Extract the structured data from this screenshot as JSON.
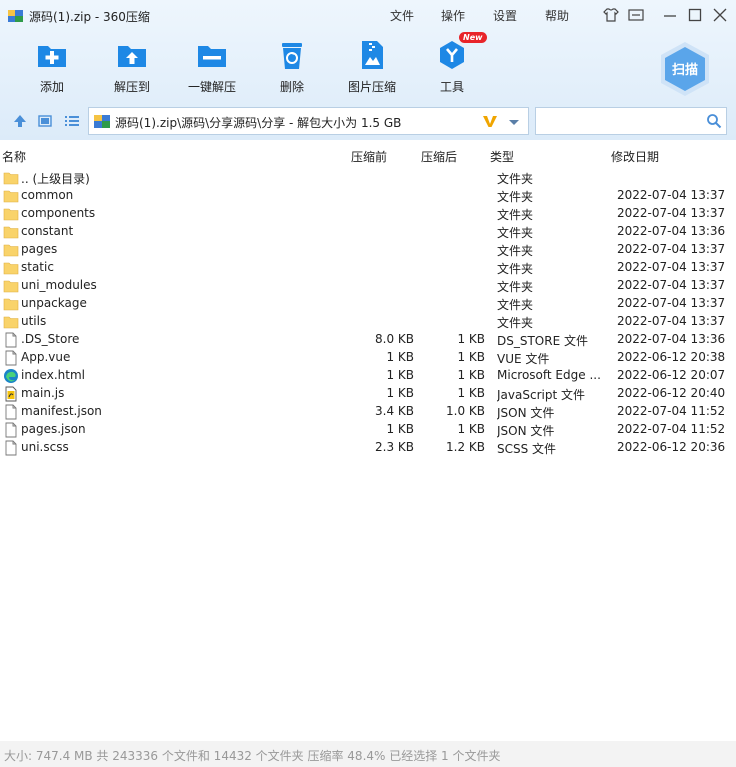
{
  "window": {
    "title": "源码(1).zip - 360压缩"
  },
  "menu": [
    "文件",
    "操作",
    "设置",
    "帮助"
  ],
  "toolbar": {
    "add": "添加",
    "extract_to": "解压到",
    "one_click": "一键解压",
    "delete": "删除",
    "image_compress": "图片压缩",
    "tools": "工具",
    "new_badge": "New",
    "scan": "扫描"
  },
  "address": {
    "path": "源码(1).zip\\源码\\分享源码\\分享 - 解包大小为 1.5 GB"
  },
  "search": {
    "value": "",
    "placeholder": ""
  },
  "columns": {
    "name": "名称",
    "before": "压缩前",
    "after": "压缩后",
    "type": "类型",
    "date": "修改日期"
  },
  "files": [
    {
      "name": ".. (上级目录)",
      "before": "",
      "after": "",
      "type": "文件夹",
      "date": "",
      "icon": "folder-icon"
    },
    {
      "name": "common",
      "before": "",
      "after": "",
      "type": "文件夹",
      "date": "2022-07-04 13:37",
      "icon": "folder-icon"
    },
    {
      "name": "components",
      "before": "",
      "after": "",
      "type": "文件夹",
      "date": "2022-07-04 13:37",
      "icon": "folder-icon"
    },
    {
      "name": "constant",
      "before": "",
      "after": "",
      "type": "文件夹",
      "date": "2022-07-04 13:36",
      "icon": "folder-icon"
    },
    {
      "name": "pages",
      "before": "",
      "after": "",
      "type": "文件夹",
      "date": "2022-07-04 13:37",
      "icon": "folder-icon"
    },
    {
      "name": "static",
      "before": "",
      "after": "",
      "type": "文件夹",
      "date": "2022-07-04 13:37",
      "icon": "folder-icon"
    },
    {
      "name": "uni_modules",
      "before": "",
      "after": "",
      "type": "文件夹",
      "date": "2022-07-04 13:37",
      "icon": "folder-icon"
    },
    {
      "name": "unpackage",
      "before": "",
      "after": "",
      "type": "文件夹",
      "date": "2022-07-04 13:37",
      "icon": "folder-icon"
    },
    {
      "name": "utils",
      "before": "",
      "after": "",
      "type": "文件夹",
      "date": "2022-07-04 13:37",
      "icon": "folder-icon"
    },
    {
      "name": ".DS_Store",
      "before": "8.0 KB",
      "after": "1 KB",
      "type": "DS_STORE 文件",
      "date": "2022-07-04 13:36",
      "icon": "file-icon"
    },
    {
      "name": "App.vue",
      "before": "1 KB",
      "after": "1 KB",
      "type": "VUE 文件",
      "date": "2022-06-12 20:38",
      "icon": "file-icon"
    },
    {
      "name": "index.html",
      "before": "1 KB",
      "after": "1 KB",
      "type": "Microsoft Edge ...",
      "date": "2022-06-12 20:07",
      "icon": "edge-icon"
    },
    {
      "name": "main.js",
      "before": "1 KB",
      "after": "1 KB",
      "type": "JavaScript 文件",
      "date": "2022-06-12 20:40",
      "icon": "script-icon"
    },
    {
      "name": "manifest.json",
      "before": "3.4 KB",
      "after": "1.0 KB",
      "type": "JSON 文件",
      "date": "2022-07-04 11:52",
      "icon": "file-icon"
    },
    {
      "name": "pages.json",
      "before": "1 KB",
      "after": "1 KB",
      "type": "JSON 文件",
      "date": "2022-07-04 11:52",
      "icon": "file-icon"
    },
    {
      "name": "uni.scss",
      "before": "2.3 KB",
      "after": "1.2 KB",
      "type": "SCSS 文件",
      "date": "2022-06-12 20:36",
      "icon": "file-icon"
    }
  ],
  "status": "大小: 747.4 MB 共 243336 个文件和 14432 个文件夹 压缩率 48.4% 已经选择 1 个文件夹",
  "colors": {
    "accent": "#1e88e5",
    "toolbar_bg": "#e4f0fb",
    "folder": "#f9d36a",
    "status_text": "#999999"
  }
}
